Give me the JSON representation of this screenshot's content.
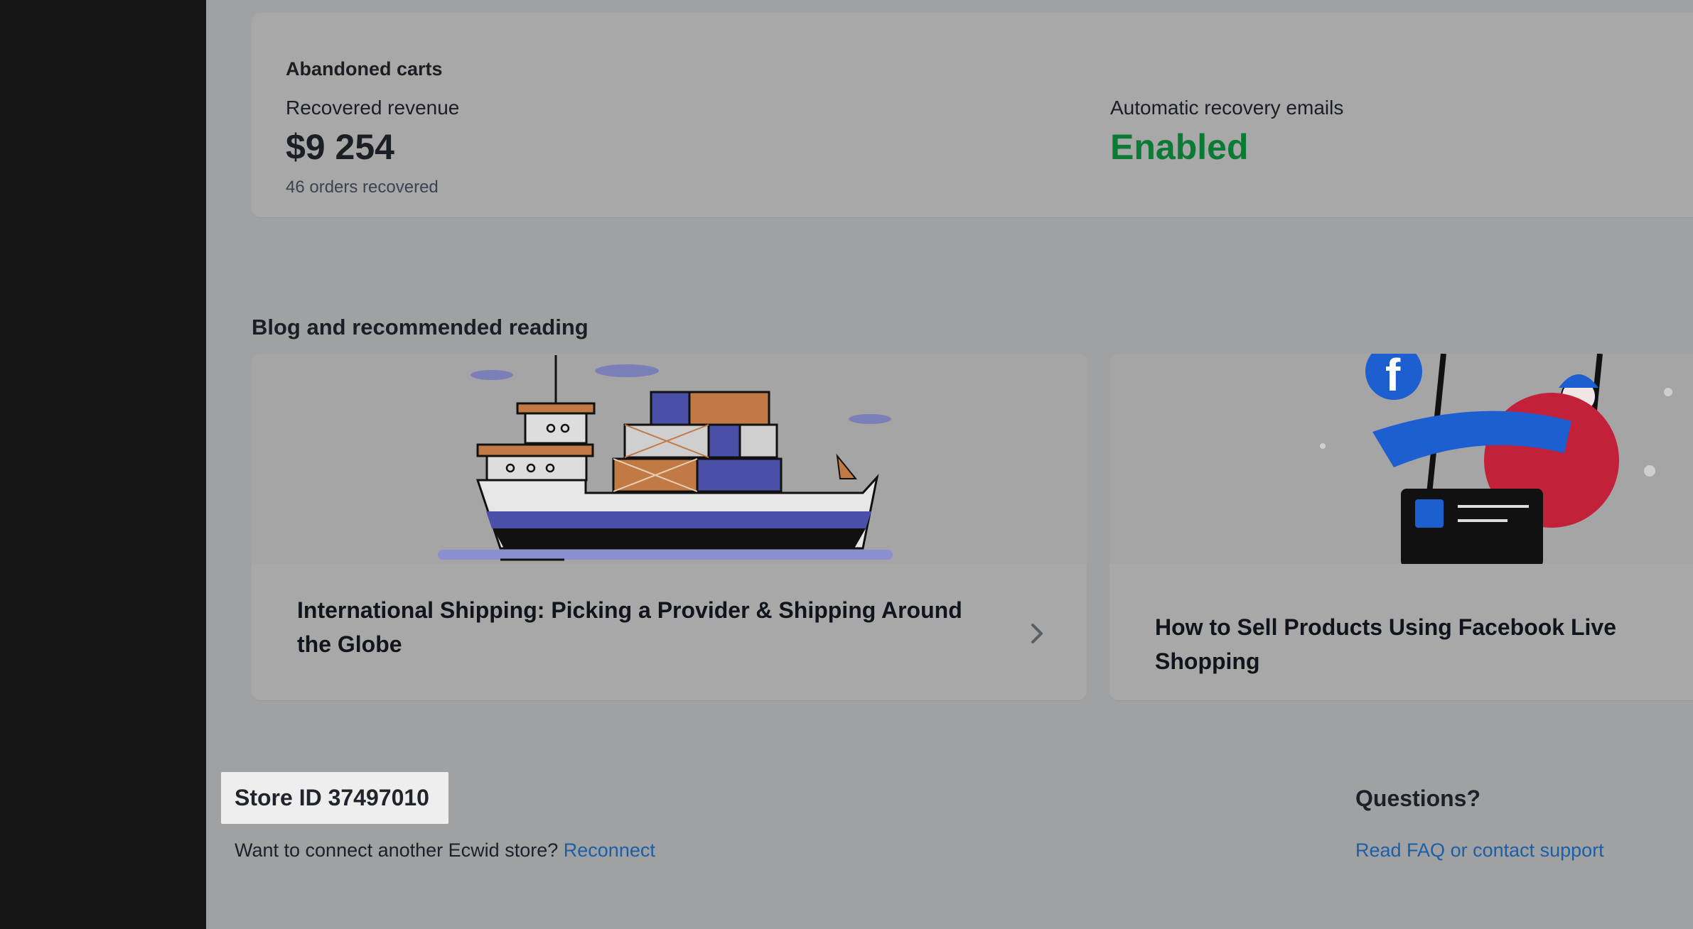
{
  "abandoned_carts": {
    "title": "Abandoned carts",
    "recovered_label": "Recovered revenue",
    "recovered_value": "$9 254",
    "orders_recovered": "46 orders recovered",
    "recovery_label": "Automatic recovery emails",
    "recovery_status": "Enabled",
    "status_color": "#0b7a34"
  },
  "blog": {
    "title": "Blog and recommended reading",
    "articles": [
      {
        "title": "International Shipping: Picking a Provider & Shipping Around the Globe",
        "illustration": "cargo-ship-illustration"
      },
      {
        "title": "How to Sell Products Using Facebook Live Shopping",
        "illustration": "facebook-live-shopper-illustration"
      }
    ]
  },
  "footer": {
    "store_id": "Store ID 37497010",
    "connect_text": "Want to connect another Ecwid store?",
    "reconnect_link": "Reconnect",
    "questions_title": "Questions?",
    "faq_link": "Read FAQ or contact support"
  }
}
